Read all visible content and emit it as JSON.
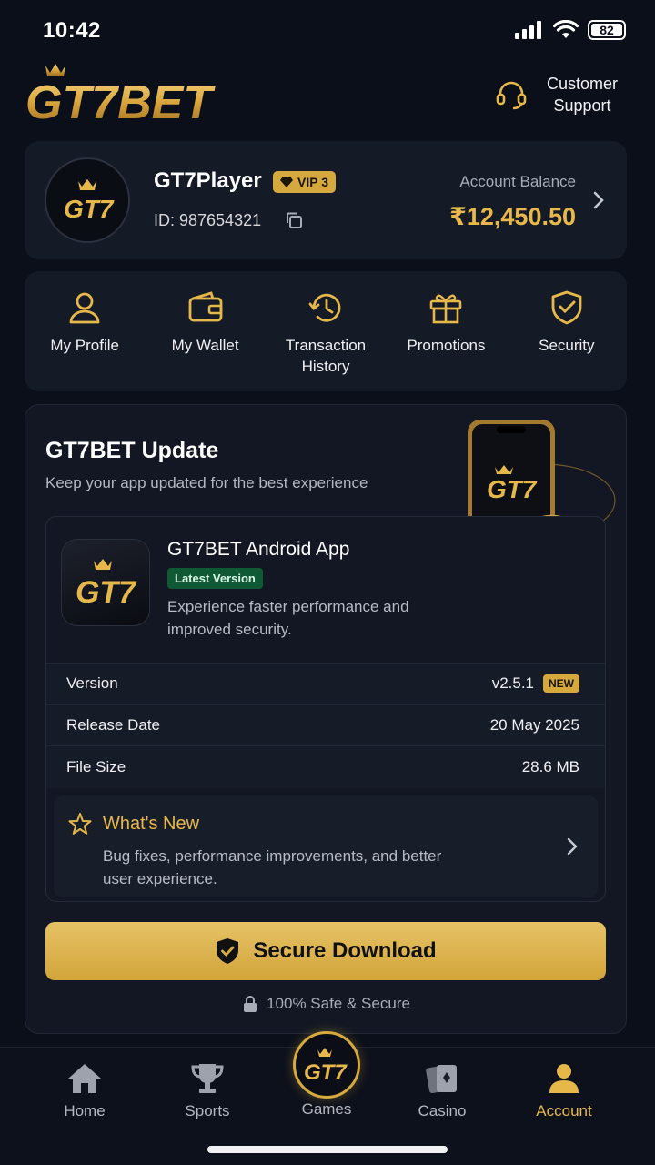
{
  "status": {
    "time": "10:42",
    "battery": "82"
  },
  "header": {
    "logo_text": "GT7BET",
    "support_label": "Customer Support"
  },
  "profile": {
    "username": "GT7Player",
    "vip": "VIP 3",
    "id_label": "ID: 987654321",
    "balance_label": "Account Balance",
    "balance_value": "₹12,450.50",
    "avatar_text": "GT7"
  },
  "quick_menu": [
    {
      "label": "My Profile",
      "icon": "user-icon"
    },
    {
      "label": "My Wallet",
      "icon": "wallet-icon"
    },
    {
      "label": "Transaction History",
      "icon": "history-icon"
    },
    {
      "label": "Promotions",
      "icon": "gift-icon"
    },
    {
      "label": "Security",
      "icon": "shield-check-icon"
    }
  ],
  "update": {
    "title": "GT7BET Update",
    "subtitle": "Keep your app updated for the best experience",
    "app_name": "GT7BET Android App",
    "badge": "Latest Version",
    "description": "Experience faster performance and improved security.",
    "rows": [
      {
        "label": "Version",
        "value": "v2.5.1",
        "badge": "NEW"
      },
      {
        "label": "Release Date",
        "value": "20 May 2025"
      },
      {
        "label": "File Size",
        "value": "28.6 MB"
      }
    ],
    "whats_new_title": "What's New",
    "whats_new_desc": "Bug fixes, performance improvements, and better user experience.",
    "download_label": "Secure Download",
    "safe_label": "100% Safe & Secure"
  },
  "nav": [
    {
      "label": "Home",
      "icon": "home-icon"
    },
    {
      "label": "Sports",
      "icon": "trophy-icon"
    },
    {
      "label": "Games",
      "icon": "gt7-logo-icon"
    },
    {
      "label": "Casino",
      "icon": "cards-icon"
    },
    {
      "label": "Account",
      "icon": "account-icon",
      "active": true
    }
  ],
  "colors": {
    "accent": "#e6b84a",
    "background": "#0b0f1a",
    "card": "#151a27",
    "success": "#0f5a35"
  }
}
